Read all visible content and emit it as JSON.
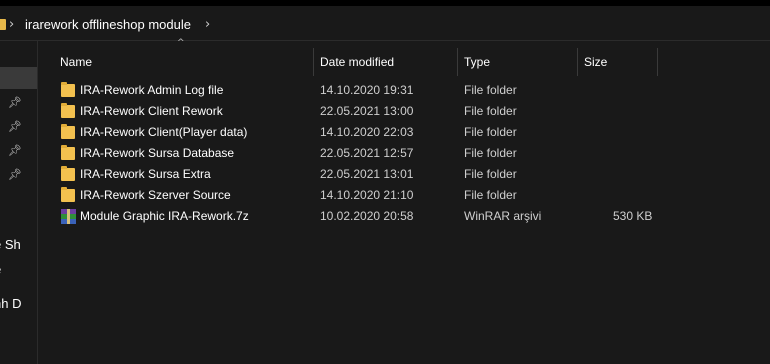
{
  "address": {
    "path_label": "irarework offlineshop module"
  },
  "sidebar": {
    "labels": [
      "e Sh",
      "e",
      "nh D"
    ]
  },
  "columns": {
    "name": "Name",
    "date": "Date modified",
    "type": "Type",
    "size": "Size"
  },
  "files": [
    {
      "name": "IRA-Rework Admin Log file",
      "date": "14.10.2020 19:31",
      "type": "File folder",
      "size": "",
      "icon": "folder-icon"
    },
    {
      "name": "IRA-Rework Client Rework",
      "date": "22.05.2021 13:00",
      "type": "File folder",
      "size": "",
      "icon": "folder-icon"
    },
    {
      "name": "IRA-Rework Client(Player data)",
      "date": "14.10.2020 22:03",
      "type": "File folder",
      "size": "",
      "icon": "folder-icon"
    },
    {
      "name": "IRA-Rework Sursa Database",
      "date": "22.05.2021 12:57",
      "type": "File folder",
      "size": "",
      "icon": "folder-icon"
    },
    {
      "name": "IRA-Rework Sursa Extra",
      "date": "22.05.2021 13:01",
      "type": "File folder",
      "size": "",
      "icon": "folder-icon"
    },
    {
      "name": "IRA-Rework Szerver Source",
      "date": "14.10.2020 21:10",
      "type": "File folder",
      "size": "",
      "icon": "folder-icon"
    },
    {
      "name": "Module Graphic IRA-Rework.7z",
      "date": "10.02.2020 20:58",
      "type": "WinRAR arşivi",
      "size": "530 KB",
      "icon": "winrar-archive-icon"
    }
  ],
  "colors": {
    "background": "#191919",
    "folder": "#f3c14f",
    "text": "#ffffff"
  }
}
